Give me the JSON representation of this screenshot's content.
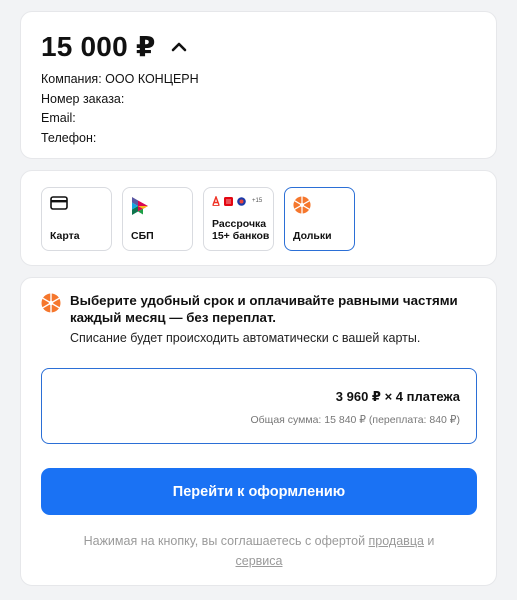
{
  "order": {
    "amount": "15 000 ₽",
    "company_label": "Компания:",
    "company_value": "ООО КОНЦЕРН",
    "order_label": "Номер заказа:",
    "email_label": "Email:",
    "phone_label": "Телефон:"
  },
  "methods": [
    {
      "label": "Карта",
      "icon": "card-icon"
    },
    {
      "label": "СБП",
      "icon": "sbp-icon"
    },
    {
      "label": "Рассрочка\n15+ банков",
      "icon": "banks-icon",
      "more": "+15"
    },
    {
      "label": "Дольки",
      "icon": "dolyami-icon",
      "selected": true
    }
  ],
  "split": {
    "title": "Выберите удобный срок и оплачивайте равными частями каждый месяц — без переплат.",
    "subtitle": "Списание будет происходить автоматически с вашей карты.",
    "plan_main": "3 960 ₽ × 4 платежа",
    "plan_total": "Общая сумма: 15 840 ₽ (переплата: 840 ₽)",
    "cta": "Перейти к оформлению",
    "legal_prefix": "Нажимая на кнопку, вы соглашаетесь с офертой",
    "legal_link_seller": "продавца",
    "legal_and": "и",
    "legal_link_service": "сервиса"
  },
  "colors": {
    "accent": "#1a72f4",
    "selected_border": "#2b6fd6",
    "dolyami_orange": "#f5772d"
  }
}
